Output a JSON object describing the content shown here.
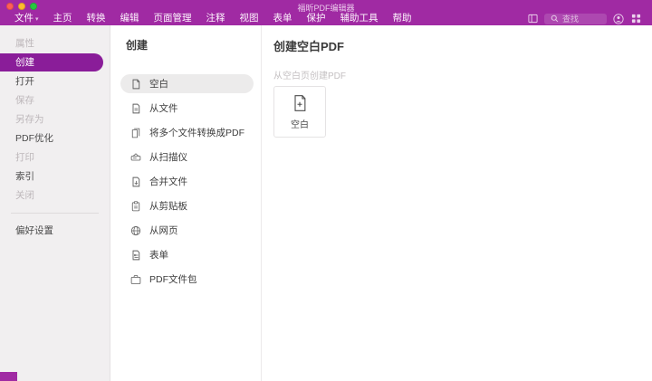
{
  "window": {
    "title": "福昕PDF编辑器"
  },
  "menu_bar": {
    "items": [
      {
        "label": "文件",
        "has_chevron": true
      },
      {
        "label": "主页"
      },
      {
        "label": "转换"
      },
      {
        "label": "编辑"
      },
      {
        "label": "页面管理"
      },
      {
        "label": "注释"
      },
      {
        "label": "视图"
      },
      {
        "label": "表单"
      },
      {
        "label": "保护"
      },
      {
        "label": "辅助工具"
      },
      {
        "label": "帮助"
      }
    ],
    "search_placeholder": "查找"
  },
  "sidebar": {
    "items": [
      {
        "label": "属性",
        "enabled": false
      },
      {
        "label": "创建",
        "enabled": true,
        "selected": true
      },
      {
        "label": "打开",
        "enabled": true
      },
      {
        "label": "保存",
        "enabled": false
      },
      {
        "label": "另存为",
        "enabled": false
      },
      {
        "label": "PDF优化",
        "enabled": true
      },
      {
        "label": "打印",
        "enabled": false
      },
      {
        "label": "索引",
        "enabled": true
      },
      {
        "label": "关闭",
        "enabled": false
      }
    ],
    "footer_item": "偏好设置"
  },
  "create_panel": {
    "title": "创建",
    "items": [
      {
        "label": "空白",
        "selected": true
      },
      {
        "label": "从文件"
      },
      {
        "label": "将多个文件转换成PDF"
      },
      {
        "label": "从扫描仪"
      },
      {
        "label": "合并文件"
      },
      {
        "label": "从剪贴板"
      },
      {
        "label": "从网页"
      },
      {
        "label": "表单"
      },
      {
        "label": "PDF文件包"
      }
    ]
  },
  "content": {
    "title": "创建空白PDF",
    "subtitle": "从空白页创建PDF",
    "card_label": "空白"
  },
  "colors": {
    "header_purple": "#A02AA3",
    "selected_purple": "#8A1D99",
    "sidebar_bg": "#F1EFF0",
    "traffic_red": "#FF5F57",
    "traffic_yellow": "#FEBC2E",
    "traffic_green": "#28C840"
  }
}
